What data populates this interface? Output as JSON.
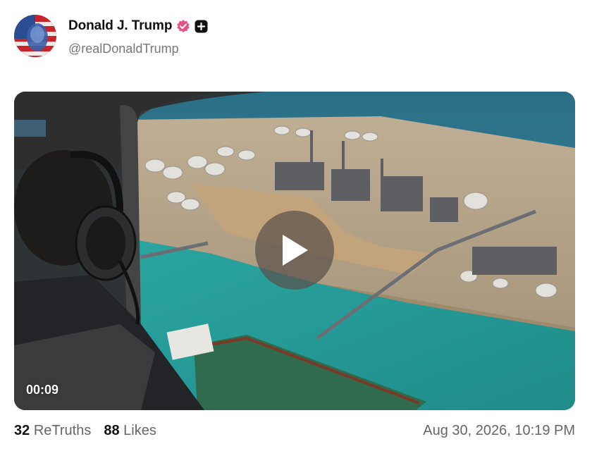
{
  "post": {
    "display_name": "Donald J. Trump",
    "handle": "@realDonaldTrump",
    "verified_icon": "verified-badge-icon",
    "plus_icon": "plus-badge-icon",
    "brand_color": "#e8508a",
    "video": {
      "duration": "00:09",
      "play_icon": "play-icon"
    },
    "stats": {
      "retruths_count": "32",
      "retruths_label": "ReTruths",
      "likes_count": "88",
      "likes_label": "Likes"
    },
    "timestamp": "Aug 30, 2026, 10:19 PM"
  }
}
